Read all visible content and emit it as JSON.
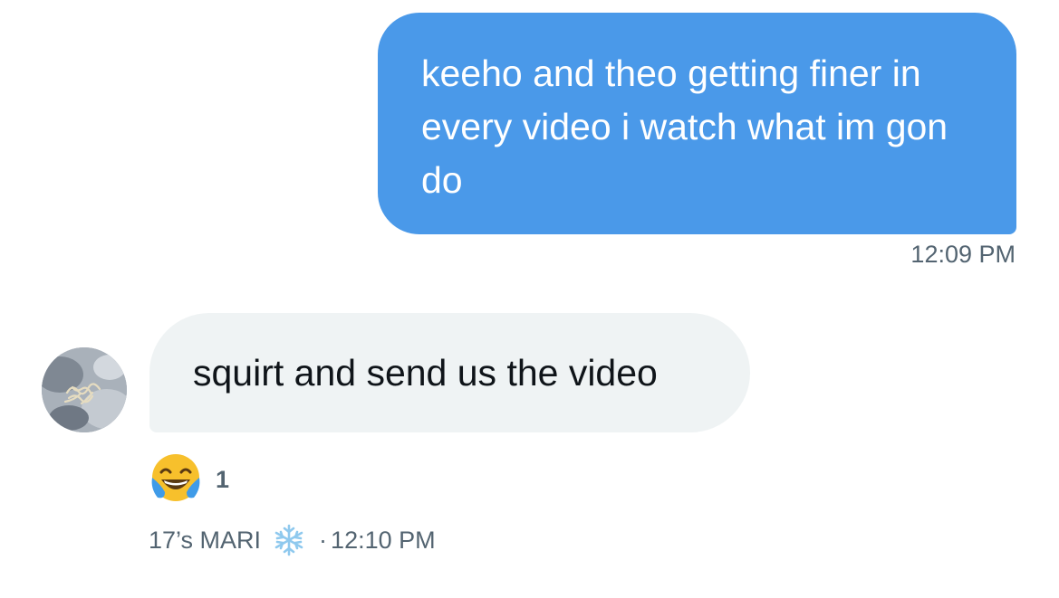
{
  "conversation": {
    "sent_message": {
      "text": "keeho and theo getting finer in every video i watch what im gon do",
      "time": "12:09 PM"
    },
    "received_message": {
      "text": "squirt and send us the video",
      "reaction": {
        "emoji": "face-with-tears-of-joy-icon",
        "count": "1"
      },
      "sender": "17’s MARI",
      "sender_badge_icon": "snowflake-icon",
      "separator": "·",
      "time": "12:10 PM"
    }
  },
  "colors": {
    "sent_bubble": "#4a99e9",
    "received_bubble": "#eff3f4",
    "secondary_text": "#536471"
  }
}
